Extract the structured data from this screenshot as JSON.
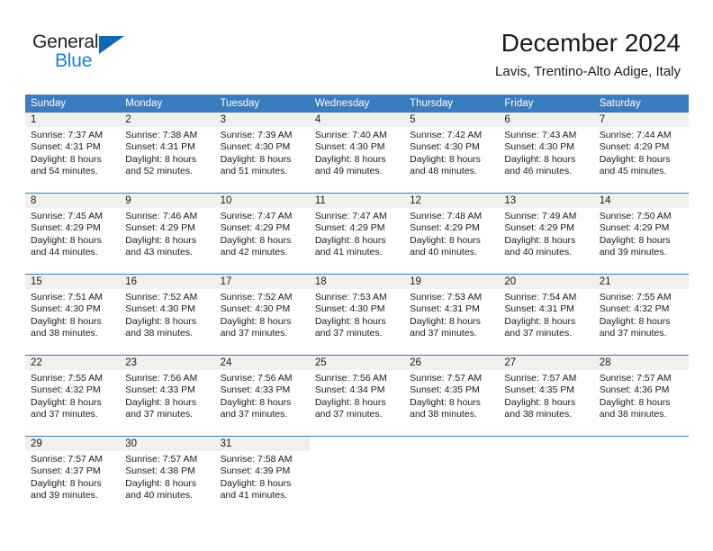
{
  "brand": {
    "name_part1": "General",
    "name_part2": "Blue",
    "triangle_color": "#1268b3",
    "blue_text_color": "#1a7fd4"
  },
  "header": {
    "title": "December 2024",
    "subtitle": "Lavis, Trentino-Alto Adige, Italy"
  },
  "theme": {
    "header_blue": "#3a7cbe",
    "day_band_gray": "#f0f0f0",
    "text_color": "#1a1a1a"
  },
  "calendar": {
    "weekday_headers": [
      "Sunday",
      "Monday",
      "Tuesday",
      "Wednesday",
      "Thursday",
      "Friday",
      "Saturday"
    ],
    "weeks": [
      [
        {
          "day": "1",
          "sunrise": "Sunrise: 7:37 AM",
          "sunset": "Sunset: 4:31 PM",
          "daylight_line1": "Daylight: 8 hours",
          "daylight_line2": "and 54 minutes."
        },
        {
          "day": "2",
          "sunrise": "Sunrise: 7:38 AM",
          "sunset": "Sunset: 4:31 PM",
          "daylight_line1": "Daylight: 8 hours",
          "daylight_line2": "and 52 minutes."
        },
        {
          "day": "3",
          "sunrise": "Sunrise: 7:39 AM",
          "sunset": "Sunset: 4:30 PM",
          "daylight_line1": "Daylight: 8 hours",
          "daylight_line2": "and 51 minutes."
        },
        {
          "day": "4",
          "sunrise": "Sunrise: 7:40 AM",
          "sunset": "Sunset: 4:30 PM",
          "daylight_line1": "Daylight: 8 hours",
          "daylight_line2": "and 49 minutes."
        },
        {
          "day": "5",
          "sunrise": "Sunrise: 7:42 AM",
          "sunset": "Sunset: 4:30 PM",
          "daylight_line1": "Daylight: 8 hours",
          "daylight_line2": "and 48 minutes."
        },
        {
          "day": "6",
          "sunrise": "Sunrise: 7:43 AM",
          "sunset": "Sunset: 4:30 PM",
          "daylight_line1": "Daylight: 8 hours",
          "daylight_line2": "and 46 minutes."
        },
        {
          "day": "7",
          "sunrise": "Sunrise: 7:44 AM",
          "sunset": "Sunset: 4:29 PM",
          "daylight_line1": "Daylight: 8 hours",
          "daylight_line2": "and 45 minutes."
        }
      ],
      [
        {
          "day": "8",
          "sunrise": "Sunrise: 7:45 AM",
          "sunset": "Sunset: 4:29 PM",
          "daylight_line1": "Daylight: 8 hours",
          "daylight_line2": "and 44 minutes."
        },
        {
          "day": "9",
          "sunrise": "Sunrise: 7:46 AM",
          "sunset": "Sunset: 4:29 PM",
          "daylight_line1": "Daylight: 8 hours",
          "daylight_line2": "and 43 minutes."
        },
        {
          "day": "10",
          "sunrise": "Sunrise: 7:47 AM",
          "sunset": "Sunset: 4:29 PM",
          "daylight_line1": "Daylight: 8 hours",
          "daylight_line2": "and 42 minutes."
        },
        {
          "day": "11",
          "sunrise": "Sunrise: 7:47 AM",
          "sunset": "Sunset: 4:29 PM",
          "daylight_line1": "Daylight: 8 hours",
          "daylight_line2": "and 41 minutes."
        },
        {
          "day": "12",
          "sunrise": "Sunrise: 7:48 AM",
          "sunset": "Sunset: 4:29 PM",
          "daylight_line1": "Daylight: 8 hours",
          "daylight_line2": "and 40 minutes."
        },
        {
          "day": "13",
          "sunrise": "Sunrise: 7:49 AM",
          "sunset": "Sunset: 4:29 PM",
          "daylight_line1": "Daylight: 8 hours",
          "daylight_line2": "and 40 minutes."
        },
        {
          "day": "14",
          "sunrise": "Sunrise: 7:50 AM",
          "sunset": "Sunset: 4:29 PM",
          "daylight_line1": "Daylight: 8 hours",
          "daylight_line2": "and 39 minutes."
        }
      ],
      [
        {
          "day": "15",
          "sunrise": "Sunrise: 7:51 AM",
          "sunset": "Sunset: 4:30 PM",
          "daylight_line1": "Daylight: 8 hours",
          "daylight_line2": "and 38 minutes."
        },
        {
          "day": "16",
          "sunrise": "Sunrise: 7:52 AM",
          "sunset": "Sunset: 4:30 PM",
          "daylight_line1": "Daylight: 8 hours",
          "daylight_line2": "and 38 minutes."
        },
        {
          "day": "17",
          "sunrise": "Sunrise: 7:52 AM",
          "sunset": "Sunset: 4:30 PM",
          "daylight_line1": "Daylight: 8 hours",
          "daylight_line2": "and 37 minutes."
        },
        {
          "day": "18",
          "sunrise": "Sunrise: 7:53 AM",
          "sunset": "Sunset: 4:30 PM",
          "daylight_line1": "Daylight: 8 hours",
          "daylight_line2": "and 37 minutes."
        },
        {
          "day": "19",
          "sunrise": "Sunrise: 7:53 AM",
          "sunset": "Sunset: 4:31 PM",
          "daylight_line1": "Daylight: 8 hours",
          "daylight_line2": "and 37 minutes."
        },
        {
          "day": "20",
          "sunrise": "Sunrise: 7:54 AM",
          "sunset": "Sunset: 4:31 PM",
          "daylight_line1": "Daylight: 8 hours",
          "daylight_line2": "and 37 minutes."
        },
        {
          "day": "21",
          "sunrise": "Sunrise: 7:55 AM",
          "sunset": "Sunset: 4:32 PM",
          "daylight_line1": "Daylight: 8 hours",
          "daylight_line2": "and 37 minutes."
        }
      ],
      [
        {
          "day": "22",
          "sunrise": "Sunrise: 7:55 AM",
          "sunset": "Sunset: 4:32 PM",
          "daylight_line1": "Daylight: 8 hours",
          "daylight_line2": "and 37 minutes."
        },
        {
          "day": "23",
          "sunrise": "Sunrise: 7:56 AM",
          "sunset": "Sunset: 4:33 PM",
          "daylight_line1": "Daylight: 8 hours",
          "daylight_line2": "and 37 minutes."
        },
        {
          "day": "24",
          "sunrise": "Sunrise: 7:56 AM",
          "sunset": "Sunset: 4:33 PM",
          "daylight_line1": "Daylight: 8 hours",
          "daylight_line2": "and 37 minutes."
        },
        {
          "day": "25",
          "sunrise": "Sunrise: 7:56 AM",
          "sunset": "Sunset: 4:34 PM",
          "daylight_line1": "Daylight: 8 hours",
          "daylight_line2": "and 37 minutes."
        },
        {
          "day": "26",
          "sunrise": "Sunrise: 7:57 AM",
          "sunset": "Sunset: 4:35 PM",
          "daylight_line1": "Daylight: 8 hours",
          "daylight_line2": "and 38 minutes."
        },
        {
          "day": "27",
          "sunrise": "Sunrise: 7:57 AM",
          "sunset": "Sunset: 4:35 PM",
          "daylight_line1": "Daylight: 8 hours",
          "daylight_line2": "and 38 minutes."
        },
        {
          "day": "28",
          "sunrise": "Sunrise: 7:57 AM",
          "sunset": "Sunset: 4:36 PM",
          "daylight_line1": "Daylight: 8 hours",
          "daylight_line2": "and 38 minutes."
        }
      ],
      [
        {
          "day": "29",
          "sunrise": "Sunrise: 7:57 AM",
          "sunset": "Sunset: 4:37 PM",
          "daylight_line1": "Daylight: 8 hours",
          "daylight_line2": "and 39 minutes."
        },
        {
          "day": "30",
          "sunrise": "Sunrise: 7:57 AM",
          "sunset": "Sunset: 4:38 PM",
          "daylight_line1": "Daylight: 8 hours",
          "daylight_line2": "and 40 minutes."
        },
        {
          "day": "31",
          "sunrise": "Sunrise: 7:58 AM",
          "sunset": "Sunset: 4:39 PM",
          "daylight_line1": "Daylight: 8 hours",
          "daylight_line2": "and 41 minutes."
        },
        {
          "day": "",
          "sunrise": "",
          "sunset": "",
          "daylight_line1": "",
          "daylight_line2": ""
        },
        {
          "day": "",
          "sunrise": "",
          "sunset": "",
          "daylight_line1": "",
          "daylight_line2": ""
        },
        {
          "day": "",
          "sunrise": "",
          "sunset": "",
          "daylight_line1": "",
          "daylight_line2": ""
        },
        {
          "day": "",
          "sunrise": "",
          "sunset": "",
          "daylight_line1": "",
          "daylight_line2": ""
        }
      ]
    ]
  }
}
